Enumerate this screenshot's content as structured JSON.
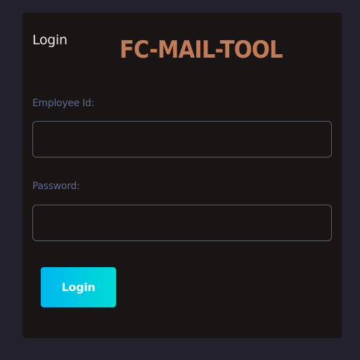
{
  "form": {
    "title": "Login",
    "brand": "FC-MAIL-TOOL",
    "employee_label": "Employee Id:",
    "employee_value": "",
    "password_label": "Password:",
    "password_value": "",
    "submit_label": "Login"
  },
  "colors": {
    "page_background": "#22212d",
    "card_background": "#191515",
    "brand": "#c17b57",
    "field_label": "#606a8e",
    "button_gradient_start": "#00b7f0",
    "button_gradient_end": "#00dcd5"
  }
}
